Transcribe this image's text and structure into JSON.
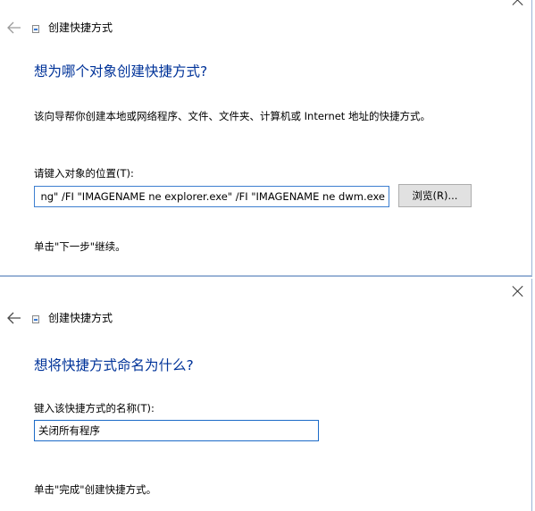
{
  "dialog1": {
    "close_label": "×",
    "back_icon": "back-arrow-icon",
    "title": "创建快捷方式",
    "heading": "想为哪个对象创建快捷方式?",
    "description": "该向导帮你创建本地或网络程序、文件、文件夹、计算机或 Internet 地址的快捷方式。",
    "field_label": "请键入对象的位置(T):",
    "field_value": "ng\" /FI \"IMAGENAME ne explorer.exe\" /FI \"IMAGENAME ne dwm.exe",
    "browse_label": "浏览(R)...",
    "footer": "单击\"下一步\"继续。"
  },
  "dialog2": {
    "close_label": "×",
    "back_icon": "back-arrow-icon",
    "title": "创建快捷方式",
    "heading": "想将快捷方式命名为什么?",
    "field_label": "键入该快捷方式的名称(T):",
    "field_value": "关闭所有程序",
    "footer": "单击\"完成\"创建快捷方式。"
  },
  "colors": {
    "heading": "#003399",
    "input_border": "#3d7fd0",
    "button_bg": "#e1e1e1",
    "window_border": "#9bb4d6"
  }
}
